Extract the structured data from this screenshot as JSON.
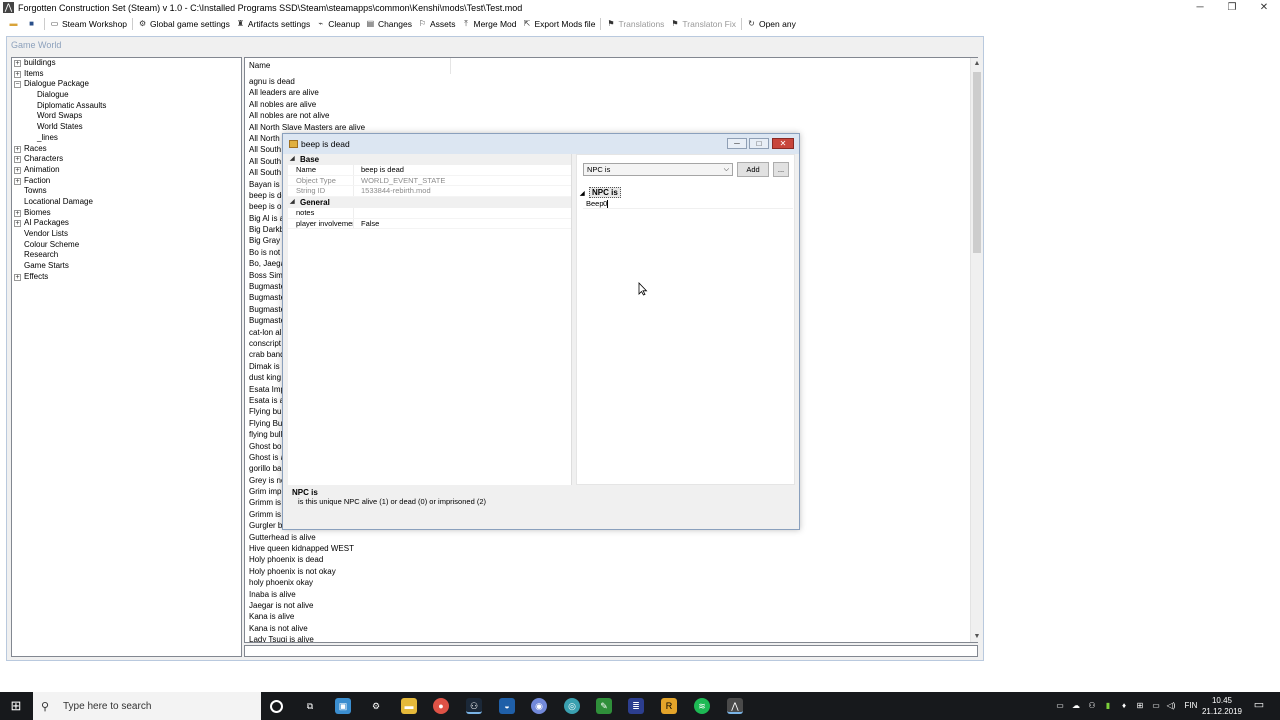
{
  "window": {
    "title": "Forgotten Construction Set (Steam) v 1.0 - C:\\Installed Programs SSD\\Steam\\steamapps\\common\\Kenshi\\mods\\Test\\Test.mod",
    "minimize": "─",
    "restore": "❐",
    "close": "✕"
  },
  "toolbar": {
    "items": [
      {
        "label": "Steam Workshop",
        "icon": "workshop-icon",
        "disabled": false
      },
      {
        "label": "Global game settings",
        "icon": "gear-icon",
        "disabled": false
      },
      {
        "label": "Artifacts settings",
        "icon": "artifact-icon",
        "disabled": false
      },
      {
        "label": "Cleanup",
        "icon": "broom-icon",
        "disabled": false
      },
      {
        "label": "Changes",
        "icon": "changes-icon",
        "disabled": false
      },
      {
        "label": "Assets",
        "icon": "assets-icon",
        "disabled": false
      },
      {
        "label": "Merge Mod",
        "icon": "merge-icon",
        "disabled": false
      },
      {
        "label": "Export Mods file",
        "icon": "export-icon",
        "disabled": false
      },
      {
        "label": "Translations",
        "icon": "translate-icon",
        "disabled": true
      },
      {
        "label": "Translaton Fix",
        "icon": "translate-fix-icon",
        "disabled": true
      },
      {
        "label": "Open any",
        "icon": "open-icon",
        "disabled": false
      }
    ]
  },
  "gameworld": {
    "title": "Game World",
    "tree": [
      {
        "label": "buildings",
        "level": 0,
        "expander": "+"
      },
      {
        "label": "Items",
        "level": 0,
        "expander": "+"
      },
      {
        "label": "Dialogue Package",
        "level": 0,
        "expander": "−"
      },
      {
        "label": "Dialogue",
        "level": 1,
        "expander": ""
      },
      {
        "label": "Diplomatic Assaults",
        "level": 1,
        "expander": ""
      },
      {
        "label": "Word Swaps",
        "level": 1,
        "expander": ""
      },
      {
        "label": "World States",
        "level": 1,
        "expander": ""
      },
      {
        "label": "_lines",
        "level": 1,
        "expander": ""
      },
      {
        "label": "Races",
        "level": 0,
        "expander": "+"
      },
      {
        "label": "Characters",
        "level": 0,
        "expander": "+"
      },
      {
        "label": "Animation",
        "level": 0,
        "expander": "+"
      },
      {
        "label": "Faction",
        "level": 0,
        "expander": "+"
      },
      {
        "label": "Towns",
        "level": 0,
        "expander": ""
      },
      {
        "label": "Locational Damage",
        "level": 0,
        "expander": ""
      },
      {
        "label": "Biomes",
        "level": 0,
        "expander": "+"
      },
      {
        "label": "AI Packages",
        "level": 0,
        "expander": "+"
      },
      {
        "label": "Vendor Lists",
        "level": 0,
        "expander": ""
      },
      {
        "label": "Colour Scheme",
        "level": 0,
        "expander": ""
      },
      {
        "label": "Research",
        "level": 0,
        "expander": ""
      },
      {
        "label": "Game Starts",
        "level": 0,
        "expander": ""
      },
      {
        "label": "Effects",
        "level": 0,
        "expander": "+"
      }
    ],
    "list_header": "Name",
    "list_items": [
      "agnu is dead",
      "All leaders are alive",
      "All nobles are alive",
      "All nobles are not alive",
      "All North Slave Masters are alive",
      "All North S",
      "All South S",
      "All South S",
      "All South S",
      "Bayan is n",
      "beep is de",
      "beep is ok",
      "Big Al is a",
      "Big Darkb",
      "Big Gray is",
      "Bo is not a",
      "Bo, Jaega",
      "Boss Simi",
      "Bugmaster",
      "Bugmaster",
      "Bugmaster",
      "Bugmaster",
      "cat-lon aliv",
      "conscript b",
      "crab band",
      "Dimak is a",
      "dust king a",
      "Esata Impr",
      "Esata is al",
      "Flying bull",
      "Flying Bull",
      "flying bull i",
      "Ghost bou",
      "Ghost is al",
      "gorillo ban",
      "Grey is not",
      "Grim impri",
      "Grimm is n",
      "Grimm is n",
      "Gurgler bo",
      "Gutterhead is alive",
      "Hive queen kidnapped WEST",
      "Holy phoenix is dead",
      "Holy phoenix is not okay",
      "holy phoenix okay",
      "Inaba is alive",
      "Jaegar is not alive",
      "Kana is alive",
      "Kana is not alive",
      "Lady Tsugi is alive"
    ],
    "scroll_up": "▲",
    "scroll_down": "▼"
  },
  "dialog": {
    "title": "beep is dead",
    "minimize": "─",
    "restore": "□",
    "close": "✕",
    "categories": [
      {
        "name": "Base",
        "rows": [
          {
            "name": "Name",
            "value": "beep is dead",
            "readonly": false
          },
          {
            "name": "Object Type",
            "value": "WORLD_EVENT_STATE",
            "readonly": true
          },
          {
            "name": "String ID",
            "value": "1533844-rebirth.mod",
            "readonly": true
          }
        ]
      },
      {
        "name": "General",
        "rows": [
          {
            "name": "notes",
            "value": "",
            "readonly": false
          },
          {
            "name": "player involvement",
            "value": "False",
            "readonly": false
          }
        ]
      }
    ],
    "combo_value": "NPC is",
    "add_label": "Add",
    "more_label": "...",
    "ref_category": "NPC is",
    "ref_name": "Beep",
    "ref_value": "0",
    "help_title": "NPC is",
    "help_desc": "is this unique NPC alive (1) or dead (0) or imprisoned (2)"
  },
  "taskbar": {
    "search_placeholder": "Type here to search",
    "language": "FIN",
    "time": "10.45",
    "date": "21.12.2019"
  }
}
